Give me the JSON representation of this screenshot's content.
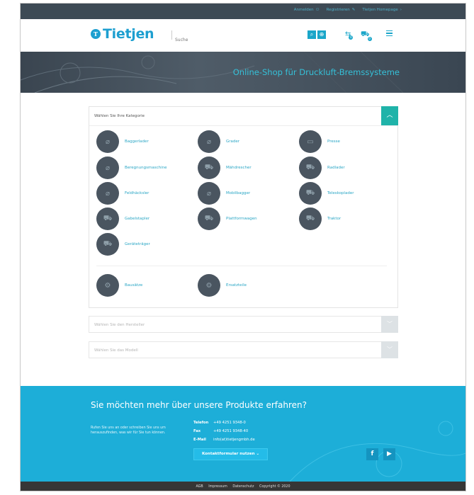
{
  "topbar": {
    "login": "Anmelden",
    "register": "Registrieren",
    "homepage": "Tietjen Homepage"
  },
  "header": {
    "logo_text": "Tietjen",
    "search_placeholder": "Suche"
  },
  "hero": {
    "title": "Online-Shop für Druckluft-Bremssysteme"
  },
  "category": {
    "label": "Wählen Sie Ihre Kategorie",
    "items": [
      {
        "label": "Baggerlader",
        "icon": "no-image-icon"
      },
      {
        "label": "Grader",
        "icon": "no-image-icon"
      },
      {
        "label": "Presse",
        "icon": "baler-icon"
      },
      {
        "label": "Beregnungsmaschine",
        "icon": "no-image-icon"
      },
      {
        "label": "Mähdrescher",
        "icon": "combine-harvester-icon"
      },
      {
        "label": "Radlader",
        "icon": "wheel-loader-icon"
      },
      {
        "label": "Feldhäcksler",
        "icon": "no-image-icon"
      },
      {
        "label": "Mobilbagger",
        "icon": "no-image-icon"
      },
      {
        "label": "Teleskoplader",
        "icon": "telehandler-icon"
      },
      {
        "label": "Gabelstapler",
        "icon": "forklift-icon"
      },
      {
        "label": "Plattformwagen",
        "icon": "platform-truck-icon"
      },
      {
        "label": "Traktor",
        "icon": "tractor-icon"
      },
      {
        "label": "Geräteträger",
        "icon": "implement-carrier-icon"
      }
    ],
    "extras": [
      {
        "label": "Bausätze",
        "icon": "kit-icon"
      },
      {
        "label": "Ersatzteile",
        "icon": "spare-parts-icon"
      }
    ]
  },
  "selects": {
    "manufacturer": "Wählen Sie den Hersteller",
    "model": "Wählen Sie das Modell"
  },
  "contact": {
    "heading": "Sie möchten mehr über unsere Produkte erfahren?",
    "intro": "Rufen Sie uns an oder schreiben Sie uns um herauszufinden, was wir für Sie tun können.",
    "phone_label": "Telefon",
    "phone": "+49 4251 9348-0",
    "fax_label": "Fax",
    "fax": "+49 4251 9348-40",
    "email_label": "E-Mail",
    "email": "info(at)tietjengmbh.de",
    "cta": "Kontaktformular nutzen"
  },
  "footer": {
    "agb": "AGB",
    "impressum": "Impressum",
    "datenschutz": "Datenschutz",
    "copyright": "Copyright © 2020"
  },
  "colors": {
    "brand": "#1d9fd0",
    "accent": "#1aa6c9",
    "teal": "#1fb3a9",
    "contact_bg": "#1daed8",
    "dark": "#3d4a55"
  }
}
